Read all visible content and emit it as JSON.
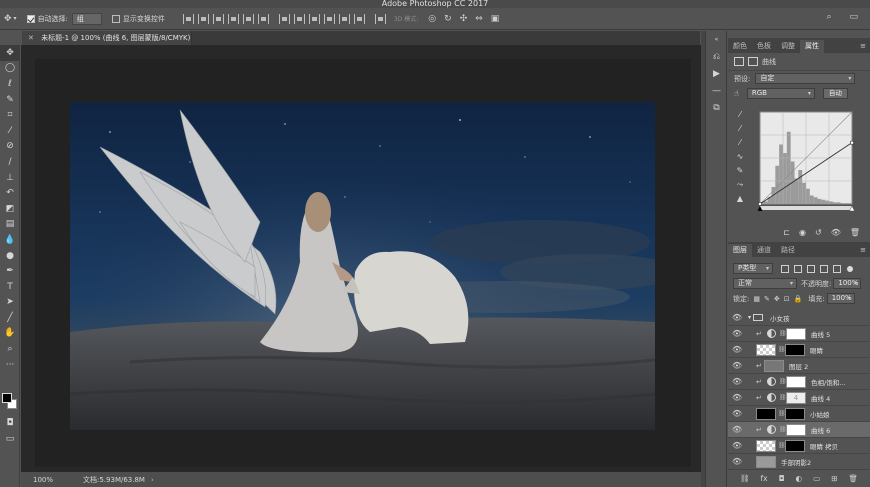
{
  "app": {
    "title": "Adobe Photoshop CC 2017"
  },
  "options_bar": {
    "move_icon": "move-tool-icon",
    "auto_select_label": "自动选择:",
    "auto_select_checked": true,
    "auto_select_value": "组",
    "show_transform_label": "显示变换控件",
    "show_transform_checked": false,
    "mode_3d_label": "3D 模式:"
  },
  "document": {
    "tab_title": "未标题-1 @ 100% (曲线 6, 图层蒙版/8/CMYK) *"
  },
  "status": {
    "zoom": "100%",
    "doc_size": "文档:5.93M/63.8M"
  },
  "tools": [
    "move-tool",
    "marquee-tool",
    "lasso-tool",
    "quick-select-tool",
    "crop-tool",
    "eyedropper-tool",
    "healing-brush-tool",
    "brush-tool",
    "clone-stamp-tool",
    "history-brush-tool",
    "eraser-tool",
    "gradient-tool",
    "blur-tool",
    "dodge-tool",
    "pen-tool",
    "type-tool",
    "path-select-tool",
    "line-tool",
    "hand-tool",
    "zoom-tool",
    "more-tools"
  ],
  "panels": {
    "top_tabs": [
      "颜色",
      "色板",
      "调整",
      "属性"
    ],
    "top_active": 3,
    "properties": {
      "title": "曲线",
      "preset_label": "预设:",
      "preset_value": "自定",
      "channel_value": "RGB",
      "auto_label": "自动"
    },
    "layers_tabs": [
      "图层",
      "通道",
      "路径"
    ],
    "layers_active": 0,
    "filter_kind": "P类型",
    "blend_mode": "正常",
    "opacity_label": "不透明度:",
    "opacity_value": "100%",
    "lock_label": "锁定:",
    "fill_label": "填充:",
    "fill_value": "100%"
  },
  "layers": [
    {
      "name": "小女孩",
      "type": "group"
    },
    {
      "name": "曲线 5",
      "type": "adjust",
      "thumb": "white"
    },
    {
      "name": "眼睛",
      "type": "layer",
      "thumb": "checker",
      "mask": "black"
    },
    {
      "name": "图层 2",
      "type": "layer",
      "thumb": "gray",
      "clip": true
    },
    {
      "name": "色相/饱和...",
      "type": "adjust",
      "thumb": "white"
    },
    {
      "name": "曲线 4",
      "type": "adjust",
      "thumb": "num",
      "num": "4"
    },
    {
      "name": "小姑娘",
      "type": "layer",
      "thumb": "black",
      "mask": "black"
    },
    {
      "name": "曲线 6",
      "type": "adjust",
      "thumb": "white",
      "selected": true
    },
    {
      "name": "眼睛 拷贝",
      "type": "layer",
      "thumb": "checker",
      "mask": "black"
    },
    {
      "name": "手部阴影2",
      "type": "layer",
      "thumb": "bgray"
    }
  ],
  "chart_data": {
    "type": "line",
    "title": "",
    "xlabel": "",
    "ylabel": "",
    "xlim": [
      0,
      255
    ],
    "ylim": [
      0,
      255
    ],
    "grid": true,
    "series": [
      {
        "values_x": [
          0,
          255
        ],
        "values_y": [
          0,
          255
        ]
      },
      {
        "values_x": [
          0,
          255
        ],
        "values_y": [
          0,
          170
        ]
      }
    ]
  }
}
